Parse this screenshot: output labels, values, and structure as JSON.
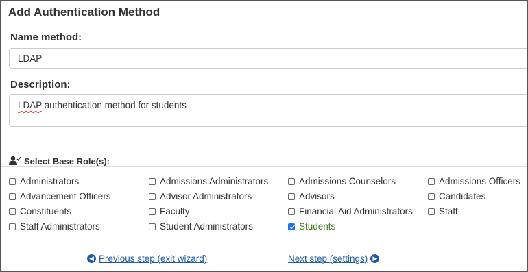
{
  "page": {
    "title": "Add Authentication Method"
  },
  "name_method": {
    "label": "Name method:",
    "value": "LDAP"
  },
  "description": {
    "label": "Description:",
    "value_word1": "LDAP",
    "value_rest": " authentication method for students"
  },
  "roles": {
    "header": "Select Base Role(s):",
    "items": [
      {
        "label": "Administrators",
        "checked": false
      },
      {
        "label": "Admissions Administrators",
        "checked": false
      },
      {
        "label": "Admissions Counselors",
        "checked": false
      },
      {
        "label": "Admissions Officers",
        "checked": false
      },
      {
        "label": "Advancement Officers",
        "checked": false
      },
      {
        "label": "Advisor Administrators",
        "checked": false
      },
      {
        "label": "Advisors",
        "checked": false
      },
      {
        "label": "Candidates",
        "checked": false
      },
      {
        "label": "Constituents",
        "checked": false
      },
      {
        "label": "Faculty",
        "checked": false
      },
      {
        "label": "Financial Aid Administrators",
        "checked": false
      },
      {
        "label": "Staff",
        "checked": false
      },
      {
        "label": "Staff Administrators",
        "checked": false
      },
      {
        "label": "Student Administrators",
        "checked": false
      },
      {
        "label": "Students",
        "checked": true
      }
    ]
  },
  "nav": {
    "previous": "Previous step (exit wizard)",
    "next": "Next step (settings)"
  },
  "icons": {
    "previous": "arrow-left-circle-icon",
    "next": "arrow-right-circle-icon",
    "roles": "user-check-icon"
  }
}
